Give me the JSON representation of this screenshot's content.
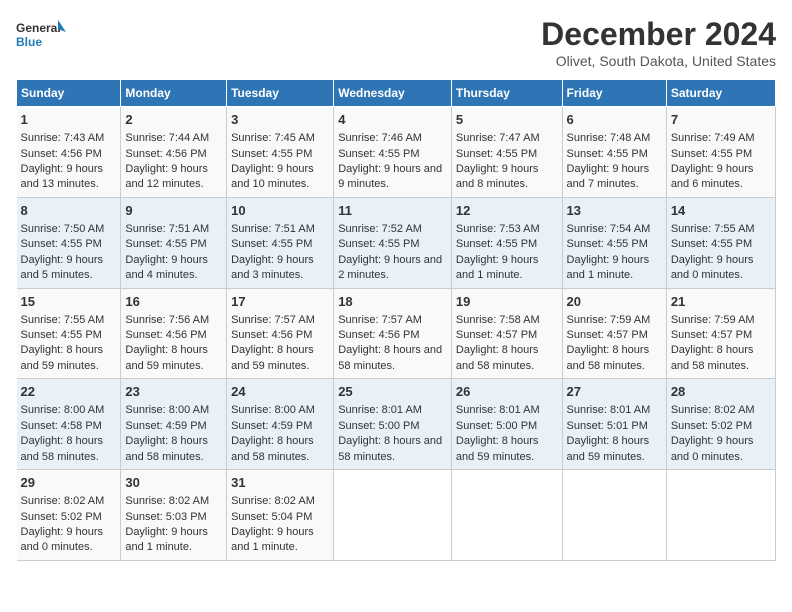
{
  "header": {
    "logo_line1": "General",
    "logo_line2": "Blue",
    "title": "December 2024",
    "subtitle": "Olivet, South Dakota, United States"
  },
  "calendar": {
    "days_of_week": [
      "Sunday",
      "Monday",
      "Tuesday",
      "Wednesday",
      "Thursday",
      "Friday",
      "Saturday"
    ],
    "weeks": [
      [
        {
          "day": "1",
          "sunrise": "7:43 AM",
          "sunset": "4:56 PM",
          "daylight": "9 hours and 13 minutes."
        },
        {
          "day": "2",
          "sunrise": "7:44 AM",
          "sunset": "4:56 PM",
          "daylight": "9 hours and 12 minutes."
        },
        {
          "day": "3",
          "sunrise": "7:45 AM",
          "sunset": "4:55 PM",
          "daylight": "9 hours and 10 minutes."
        },
        {
          "day": "4",
          "sunrise": "7:46 AM",
          "sunset": "4:55 PM",
          "daylight": "9 hours and 9 minutes."
        },
        {
          "day": "5",
          "sunrise": "7:47 AM",
          "sunset": "4:55 PM",
          "daylight": "9 hours and 8 minutes."
        },
        {
          "day": "6",
          "sunrise": "7:48 AM",
          "sunset": "4:55 PM",
          "daylight": "9 hours and 7 minutes."
        },
        {
          "day": "7",
          "sunrise": "7:49 AM",
          "sunset": "4:55 PM",
          "daylight": "9 hours and 6 minutes."
        }
      ],
      [
        {
          "day": "8",
          "sunrise": "7:50 AM",
          "sunset": "4:55 PM",
          "daylight": "9 hours and 5 minutes."
        },
        {
          "day": "9",
          "sunrise": "7:51 AM",
          "sunset": "4:55 PM",
          "daylight": "9 hours and 4 minutes."
        },
        {
          "day": "10",
          "sunrise": "7:51 AM",
          "sunset": "4:55 PM",
          "daylight": "9 hours and 3 minutes."
        },
        {
          "day": "11",
          "sunrise": "7:52 AM",
          "sunset": "4:55 PM",
          "daylight": "9 hours and 2 minutes."
        },
        {
          "day": "12",
          "sunrise": "7:53 AM",
          "sunset": "4:55 PM",
          "daylight": "9 hours and 1 minute."
        },
        {
          "day": "13",
          "sunrise": "7:54 AM",
          "sunset": "4:55 PM",
          "daylight": "9 hours and 1 minute."
        },
        {
          "day": "14",
          "sunrise": "7:55 AM",
          "sunset": "4:55 PM",
          "daylight": "9 hours and 0 minutes."
        }
      ],
      [
        {
          "day": "15",
          "sunrise": "7:55 AM",
          "sunset": "4:55 PM",
          "daylight": "8 hours and 59 minutes."
        },
        {
          "day": "16",
          "sunrise": "7:56 AM",
          "sunset": "4:56 PM",
          "daylight": "8 hours and 59 minutes."
        },
        {
          "day": "17",
          "sunrise": "7:57 AM",
          "sunset": "4:56 PM",
          "daylight": "8 hours and 59 minutes."
        },
        {
          "day": "18",
          "sunrise": "7:57 AM",
          "sunset": "4:56 PM",
          "daylight": "8 hours and 58 minutes."
        },
        {
          "day": "19",
          "sunrise": "7:58 AM",
          "sunset": "4:57 PM",
          "daylight": "8 hours and 58 minutes."
        },
        {
          "day": "20",
          "sunrise": "7:59 AM",
          "sunset": "4:57 PM",
          "daylight": "8 hours and 58 minutes."
        },
        {
          "day": "21",
          "sunrise": "7:59 AM",
          "sunset": "4:57 PM",
          "daylight": "8 hours and 58 minutes."
        }
      ],
      [
        {
          "day": "22",
          "sunrise": "8:00 AM",
          "sunset": "4:58 PM",
          "daylight": "8 hours and 58 minutes."
        },
        {
          "day": "23",
          "sunrise": "8:00 AM",
          "sunset": "4:59 PM",
          "daylight": "8 hours and 58 minutes."
        },
        {
          "day": "24",
          "sunrise": "8:00 AM",
          "sunset": "4:59 PM",
          "daylight": "8 hours and 58 minutes."
        },
        {
          "day": "25",
          "sunrise": "8:01 AM",
          "sunset": "5:00 PM",
          "daylight": "8 hours and 58 minutes."
        },
        {
          "day": "26",
          "sunrise": "8:01 AM",
          "sunset": "5:00 PM",
          "daylight": "8 hours and 59 minutes."
        },
        {
          "day": "27",
          "sunrise": "8:01 AM",
          "sunset": "5:01 PM",
          "daylight": "8 hours and 59 minutes."
        },
        {
          "day": "28",
          "sunrise": "8:02 AM",
          "sunset": "5:02 PM",
          "daylight": "9 hours and 0 minutes."
        }
      ],
      [
        {
          "day": "29",
          "sunrise": "8:02 AM",
          "sunset": "5:02 PM",
          "daylight": "9 hours and 0 minutes."
        },
        {
          "day": "30",
          "sunrise": "8:02 AM",
          "sunset": "5:03 PM",
          "daylight": "9 hours and 1 minute."
        },
        {
          "day": "31",
          "sunrise": "8:02 AM",
          "sunset": "5:04 PM",
          "daylight": "9 hours and 1 minute."
        },
        null,
        null,
        null,
        null
      ]
    ]
  },
  "labels": {
    "sunrise": "Sunrise:",
    "sunset": "Sunset:",
    "daylight": "Daylight:"
  }
}
